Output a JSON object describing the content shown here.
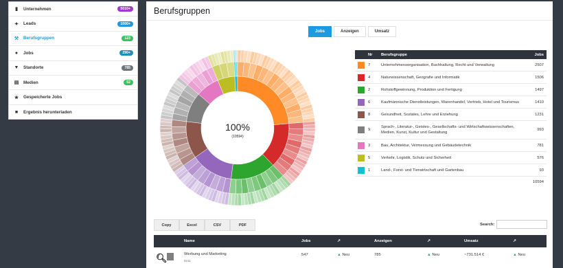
{
  "sidebar": {
    "items": [
      {
        "label": "Unternehmen",
        "badge": "5010+",
        "badge_color": "#a237d8",
        "icon": "building-icon"
      },
      {
        "label": "Leads",
        "badge": "1000+",
        "badge_color": "#1c9be0",
        "icon": "wand-icon"
      },
      {
        "label": "Berufsgruppen",
        "badge": "123",
        "badge_color": "#3bbf62",
        "icon": "hammer-icon",
        "active": true
      },
      {
        "label": "Jobs",
        "badge": "290+",
        "badge_color": "#1c93b5",
        "icon": "user-icon"
      },
      {
        "label": "Standorte",
        "badge": "785",
        "badge_color": "#6c757d",
        "icon": "map-marker-icon"
      },
      {
        "label": "Medien",
        "badge": "52",
        "badge_color": "#3bbf62",
        "icon": "newspaper-icon"
      },
      {
        "label": "Gespeicherte Jobs",
        "badge": "",
        "icon": "star-icon"
      },
      {
        "label": "Ergebnis herunterladen",
        "badge": "",
        "icon": "document-icon"
      }
    ]
  },
  "main": {
    "title": "Berufsgruppen",
    "tabs": [
      {
        "label": "Jobs",
        "active": true
      },
      {
        "label": "Anzeigen",
        "active": false
      },
      {
        "label": "Umsatz",
        "active": false
      }
    ]
  },
  "donut": {
    "center_value": "100%",
    "center_sub": "(10594)"
  },
  "category_table": {
    "headers": {
      "nr": "Nr",
      "name": "Berufsgruppe",
      "jobs": "Jobs"
    },
    "rows": [
      {
        "color": "#ff8a26",
        "nr": "7",
        "name": "Unternehmensorganisation, Buchhaltung, Recht und Verwaltung",
        "jobs": "2507"
      },
      {
        "color": "#d42a2a",
        "nr": "4",
        "name": "Naturwissenschaft, Geografie und Informatik",
        "jobs": "1506"
      },
      {
        "color": "#2ea52e",
        "nr": "2",
        "name": "Rohstoffgewinnung, Produktion und Fertigung",
        "jobs": "1497"
      },
      {
        "color": "#9467bd",
        "nr": "6",
        "name": "Kaufmännische Dienstleistungen, Warenhandel, Vertrieb, Hotel und Tourismus",
        "jobs": "1410"
      },
      {
        "color": "#8c564b",
        "nr": "8",
        "name": "Gesundheit, Soziales, Lehre und Erziehung",
        "jobs": "1231"
      },
      {
        "color": "#7f7f7f",
        "nr": "9",
        "name": "Sprach-, Literatur-, Geistes-, Gesellschafts- und Wirtschaftswissenschaften, Medien, Kunst, Kultur und Gestaltung",
        "jobs": "993"
      },
      {
        "color": "#e377c2",
        "nr": "3",
        "name": "Bau, Architektur, Vermessung und Gebäudetechnik",
        "jobs": "781"
      },
      {
        "color": "#bcbd22",
        "nr": "5",
        "name": "Verkehr, Logistik, Schutz und Sicherheit",
        "jobs": "576"
      },
      {
        "color": "#17becf",
        "nr": "1",
        "name": "Land-, Forst- und Tierwirtschaft und Gartenbau",
        "jobs": "93"
      }
    ],
    "total": "10594"
  },
  "export_buttons": [
    "Copy",
    "Excel",
    "CSV",
    "PDF"
  ],
  "search": {
    "label": "Search:",
    "value": ""
  },
  "data_table": {
    "headers": {
      "name": "Name",
      "jobs": "Jobs",
      "ads": "Anzeigen",
      "revenue": "Umsatz"
    },
    "row": {
      "name": "Werbung und Marketing",
      "code": "9211",
      "jobs": "547",
      "jobs_trend": "Neu",
      "ads": "785",
      "ads_trend": "Neu",
      "revenue": "~731.514 €",
      "revenue_trend": "Neu"
    }
  }
}
